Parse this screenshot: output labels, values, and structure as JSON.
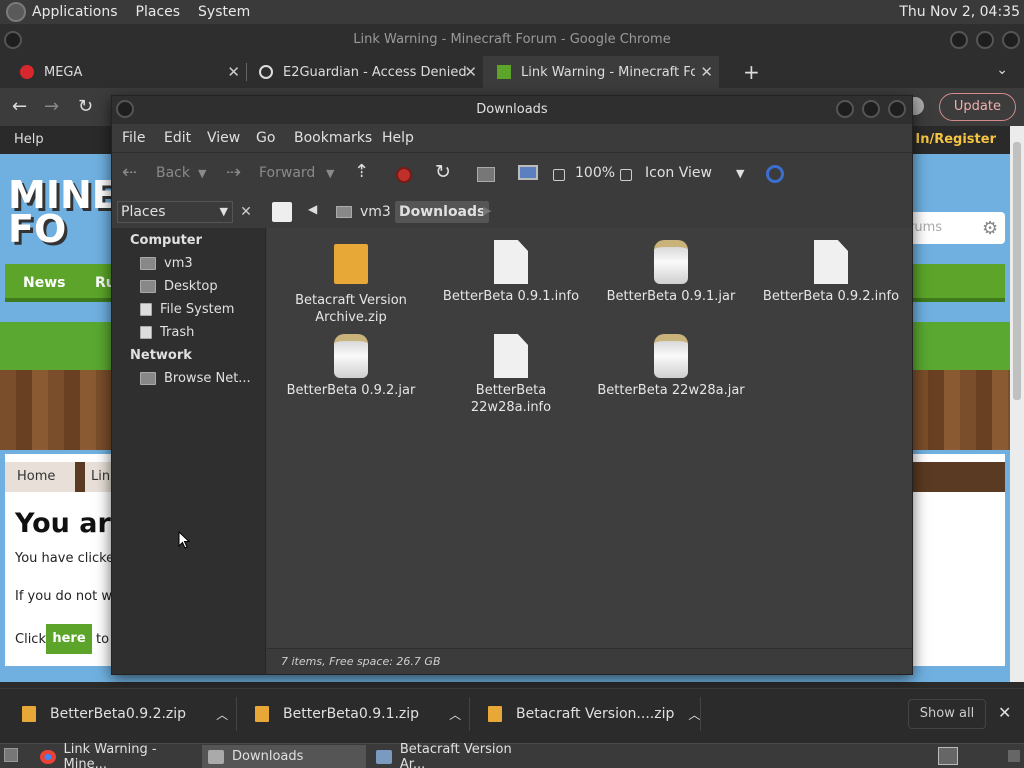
{
  "top_panel": {
    "menus": [
      "Applications",
      "Places",
      "System"
    ],
    "clock": "Thu Nov 2, 04:35"
  },
  "chrome": {
    "window_title": "Link Warning - Minecraft Forum - Google Chrome",
    "tabs": [
      {
        "label": "MEGA",
        "icon": "mega-icon"
      },
      {
        "label": "E2Guardian - Access Denied",
        "icon": "globe-icon"
      },
      {
        "label": "Link Warning - Minecraft Foru",
        "icon": "minecraft-icon"
      }
    ],
    "new_tab": "+",
    "update_label": "Update"
  },
  "webpage": {
    "help": "Help",
    "login": "gn In/Register",
    "logo": "MINE FO",
    "search_placeholder": "rums",
    "nav": [
      "News",
      "Ru"
    ],
    "breadcrumbs": [
      "Home",
      "Link"
    ],
    "heading": "You are",
    "line1": "You have clicked",
    "line2": "If you do not war",
    "click_prefix": "Click",
    "here": "here",
    "click_suffix": "to"
  },
  "file_manager": {
    "title": "Downloads",
    "menus": [
      "File",
      "Edit",
      "View",
      "Go",
      "Bookmarks",
      "Help"
    ],
    "toolbar": {
      "back": "Back",
      "forward": "Forward",
      "zoom": "100%",
      "view_mode": "Icon View"
    },
    "sidebar_selector": "Places",
    "breadcrumbs": [
      "vm3",
      "Downloads"
    ],
    "sidebar": {
      "computer_heading": "Computer",
      "computer_items": [
        "vm3",
        "Desktop",
        "File System",
        "Trash"
      ],
      "network_heading": "Network",
      "network_items": [
        "Browse Net..."
      ]
    },
    "files": [
      {
        "name": "Betacraft Version Archive.zip",
        "type": "zip"
      },
      {
        "name": "BetterBeta 0.9.1.info",
        "type": "doc"
      },
      {
        "name": "BetterBeta 0.9.1.jar",
        "type": "jar"
      },
      {
        "name": "BetterBeta 0.9.2.info",
        "type": "doc"
      },
      {
        "name": "BetterBeta 0.9.2.jar",
        "type": "jar"
      },
      {
        "name": "BetterBeta 22w28a.info",
        "type": "doc"
      },
      {
        "name": "BetterBeta 22w28a.jar",
        "type": "jar"
      }
    ],
    "status": "7 items, Free space: 26.7 GB"
  },
  "downloads": {
    "items": [
      "BetterBeta0.9.2.zip",
      "BetterBeta0.9.1.zip",
      "Betacraft Version....zip"
    ],
    "show_all": "Show all"
  },
  "taskbar": {
    "tasks": [
      "Link Warning - Mine...",
      "Downloads",
      "Betacraft Version Ar..."
    ]
  }
}
